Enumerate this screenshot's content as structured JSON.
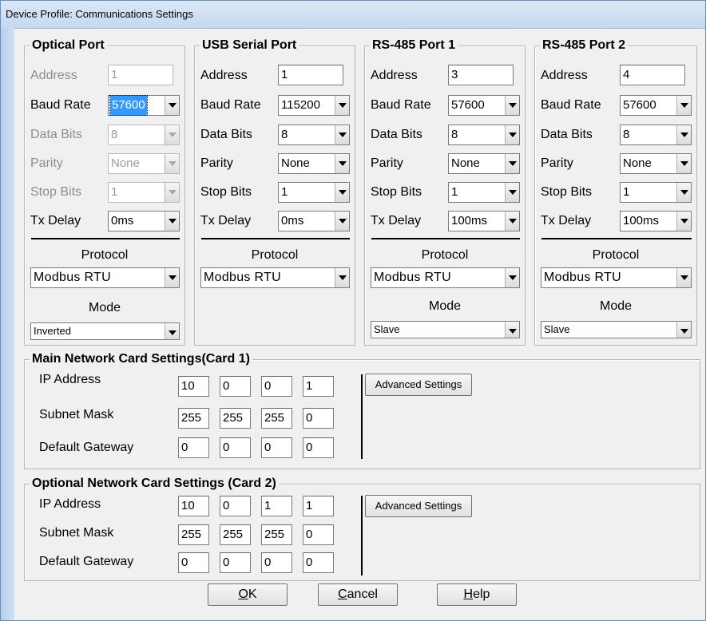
{
  "window": {
    "title": "Device Profile: Communications Settings"
  },
  "labels": {
    "address": "Address",
    "baud_rate": "Baud Rate",
    "data_bits": "Data Bits",
    "parity": "Parity",
    "stop_bits": "Stop Bits",
    "tx_delay": "Tx Delay",
    "protocol": "Protocol",
    "mode": "Mode",
    "ip_address": "IP Address",
    "subnet_mask": "Subnet Mask",
    "default_gateway": "Default Gateway"
  },
  "ports": [
    {
      "name": "Optical Port",
      "address": "1",
      "baud_rate": "57600",
      "data_bits": "8",
      "parity": "None",
      "stop_bits": "1",
      "tx_delay": "0ms",
      "protocol": "Modbus RTU",
      "mode": "Inverted"
    },
    {
      "name": "USB Serial Port",
      "address": "1",
      "baud_rate": "115200",
      "data_bits": "8",
      "parity": "None",
      "stop_bits": "1",
      "tx_delay": "0ms",
      "protocol": "Modbus RTU"
    },
    {
      "name": "RS-485 Port 1",
      "address": "3",
      "baud_rate": "57600",
      "data_bits": "8",
      "parity": "None",
      "stop_bits": "1",
      "tx_delay": "100ms",
      "protocol": "Modbus RTU",
      "mode": "Slave"
    },
    {
      "name": "RS-485 Port 2",
      "address": "4",
      "baud_rate": "57600",
      "data_bits": "8",
      "parity": "None",
      "stop_bits": "1",
      "tx_delay": "100ms",
      "protocol": "Modbus RTU",
      "mode": "Slave"
    }
  ],
  "network_cards": [
    {
      "title": "Main Network Card Settings(Card 1)",
      "ip": [
        "10",
        "0",
        "0",
        "1"
      ],
      "subnet": [
        "255",
        "255",
        "255",
        "0"
      ],
      "gateway": [
        "0",
        "0",
        "0",
        "0"
      ],
      "advanced_label": "Advanced Settings"
    },
    {
      "title": "Optional Network Card Settings (Card 2)",
      "ip": [
        "10",
        "0",
        "1",
        "1"
      ],
      "subnet": [
        "255",
        "255",
        "255",
        "0"
      ],
      "gateway": [
        "0",
        "0",
        "0",
        "0"
      ],
      "advanced_label": "Advanced Settings"
    }
  ],
  "buttons": {
    "ok": {
      "prefix": "",
      "mnemonic": "O",
      "rest": "K"
    },
    "cancel": {
      "prefix": "",
      "mnemonic": "C",
      "rest": "ancel"
    },
    "help": {
      "prefix": "",
      "mnemonic": "H",
      "rest": "elp"
    }
  }
}
